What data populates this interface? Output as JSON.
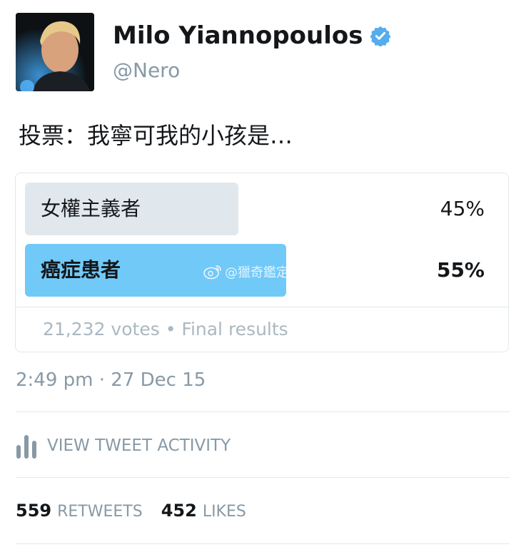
{
  "author": {
    "display_name": "Milo Yiannopoulos",
    "handle": "@Nero",
    "verified_icon": "verified-badge-icon"
  },
  "tweet": {
    "text": "投票：我寧可我的小孩是…"
  },
  "poll": {
    "options": [
      {
        "label": "女權主義者",
        "percent_text": "45%",
        "percent": 45,
        "winner": false
      },
      {
        "label": "癌症患者",
        "percent_text": "55%",
        "percent": 55,
        "winner": true
      }
    ],
    "votes_text": "21,232 votes",
    "separator": "•",
    "status_text": "Final results",
    "colors": {
      "winner": "#71c9f8",
      "other": "#e1e8ed"
    }
  },
  "watermark": {
    "text": "@獵奇鑑定中心",
    "icon": "weibo-icon"
  },
  "timestamp": "2:49 pm · 27 Dec 15",
  "activity": {
    "label": "VIEW TWEET ACTIVITY",
    "icon": "bar-chart-icon"
  },
  "stats": {
    "retweets_count": "559",
    "retweets_label": "RETWEETS",
    "likes_count": "452",
    "likes_label": "LIKES"
  }
}
